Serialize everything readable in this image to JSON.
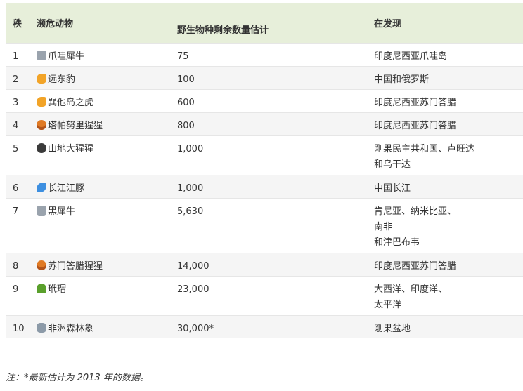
{
  "table": {
    "headers": {
      "rank": "秩",
      "animal": "濒危动物",
      "count": "野生物种剩余数量估计",
      "location": "在发现"
    },
    "rows": [
      {
        "rank": "1",
        "icon": "rhino-icon",
        "animal": "爪哇犀牛",
        "count": "75",
        "location_lines": [
          "印度尼西亚爪哇岛"
        ]
      },
      {
        "rank": "2",
        "icon": "leopard-icon",
        "animal": "远东豹",
        "count": "100",
        "location_lines": [
          "中国和俄罗斯"
        ]
      },
      {
        "rank": "3",
        "icon": "leopard-icon",
        "animal": "巽他岛之虎",
        "count": "600",
        "location_lines": [
          "印度尼西亚苏门答腊"
        ]
      },
      {
        "rank": "4",
        "icon": "orangutan-icon",
        "animal": "塔帕努里猩猩",
        "count": "800",
        "location_lines": [
          "印度尼西亚苏门答腊"
        ]
      },
      {
        "rank": "5",
        "icon": "gorilla-icon",
        "animal": "山地大猩猩",
        "count": "1,000",
        "location_lines": [
          "刚果民主共和国、卢旺达",
          "和乌干达"
        ]
      },
      {
        "rank": "6",
        "icon": "dolphin-icon",
        "animal": "长江江豚",
        "count": "1,000",
        "location_lines": [
          "中国长江"
        ]
      },
      {
        "rank": "7",
        "icon": "rhino-icon",
        "animal": "黑犀牛",
        "count": "5,630",
        "location_lines": [
          "肯尼亚、纳米比亚、",
          "南非",
          "和津巴布韦"
        ]
      },
      {
        "rank": "8",
        "icon": "orangutan-icon",
        "animal": "苏门答腊猩猩",
        "count": "14,000",
        "location_lines": [
          "印度尼西亚苏门答腊"
        ]
      },
      {
        "rank": "9",
        "icon": "turtle-icon",
        "animal": "玳瑁",
        "count": "23,000",
        "location_lines": [
          "大西洋、印度洋、",
          "太平洋"
        ]
      },
      {
        "rank": "10",
        "icon": "elephant-icon",
        "animal": "非洲森林象",
        "count": "30,000*",
        "location_lines": [
          "刚果盆地"
        ]
      }
    ]
  },
  "footnote": "注：*最新估计为 2013 年的数据。"
}
